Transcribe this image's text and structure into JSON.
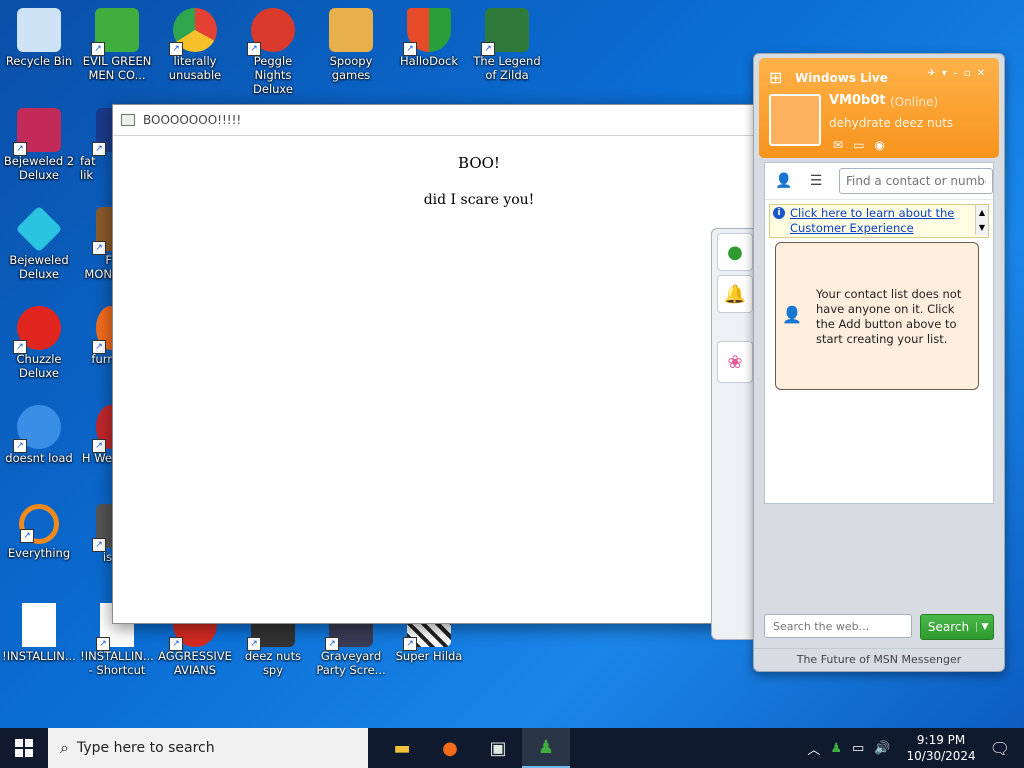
{
  "desktop": {
    "icons": [
      {
        "label": "Recycle Bin",
        "icon": "recycle-bin-icon",
        "color": "#b7d7f7"
      },
      {
        "label": "EVIL GREEN MEN CO...",
        "icon": "messenger-icon",
        "color": "#3fae3f"
      },
      {
        "label": "literally unusable",
        "icon": "chrome-icon",
        "color": "#e44134"
      },
      {
        "label": "Peggle Nights Deluxe",
        "icon": "peggle-icon",
        "color": "#d93a2b"
      },
      {
        "label": "Spoopy games",
        "icon": "folder-icon",
        "color": "#e8b04a"
      },
      {
        "label": "HalloDock",
        "icon": "shield-icon",
        "color": "#e64b2a"
      },
      {
        "label": "The Legend of Zilda",
        "icon": "zelda-icon",
        "color": "#2f7a3a"
      },
      {
        "label": "Bejeweled 2 Deluxe",
        "icon": "bejeweled2-icon",
        "color": "#c22a5a"
      },
      {
        "label": "fat lik",
        "icon": "game-icon",
        "color": "#1b3a8c"
      },
      {
        "label": "Bejeweled Deluxe",
        "icon": "gem-icon",
        "color": "#2bc4e0"
      },
      {
        "label": "F MON",
        "icon": "game-icon",
        "color": "#8b5a2b"
      },
      {
        "label": "Chuzzle Deluxe",
        "icon": "chuzzle-icon",
        "color": "#e0261e"
      },
      {
        "label": "furr",
        "icon": "firefox-icon",
        "color": "#f26b1d"
      },
      {
        "label": "doesnt load",
        "icon": "thunderbird-icon",
        "color": "#3a8ee6"
      },
      {
        "label": "H We",
        "icon": "game-icon",
        "color": "#c2282c"
      },
      {
        "label": "Everything",
        "icon": "search-everything-icon",
        "color": "#f08a1c"
      },
      {
        "label": "is",
        "icon": "game-icon",
        "color": "#555555"
      },
      {
        "label": "!INSTALLIN...",
        "icon": "document-icon",
        "color": "#ffffff"
      },
      {
        "label": "!INSTALLIN... - Shortcut",
        "icon": "document-icon",
        "color": "#ffffff"
      },
      {
        "label": "AGGRESSIVE AVIANS",
        "icon": "angry-bird-icon",
        "color": "#d42a22"
      },
      {
        "label": "deez nuts spy",
        "icon": "spy-icon",
        "color": "#333333"
      },
      {
        "label": "Graveyard Party Scre...",
        "icon": "graveyard-icon",
        "color": "#3b3b55"
      },
      {
        "label": "Super Hilda",
        "icon": "hilda-icon",
        "color": "#c8c8c8"
      }
    ]
  },
  "boo_window": {
    "title": "BOOOOOOO!!!!!",
    "heading": "BOO!",
    "message": "did I scare you!"
  },
  "messenger": {
    "brand": "Windows Live",
    "username": "VM0b0t",
    "status": "(Online)",
    "personal_message": "dehydrate deez nuts",
    "contact_search_placeholder": "Find a contact or number",
    "info_link": "Click here to learn about the Customer Experience",
    "empty_message": "Your contact list does not have anyone on it.  Click the Add button above to start creating your list.",
    "web_search_placeholder": "Search the web...",
    "search_button": "Search",
    "footer": "The Future of MSN Messenger",
    "accent_color": "#f7941d"
  },
  "taskbar": {
    "search_placeholder": "Type here to search",
    "apps": [
      "file-explorer-icon",
      "firefox-icon",
      "window-app-icon",
      "messenger-icon"
    ],
    "time": "9:19 PM",
    "date": "10/30/2024"
  }
}
